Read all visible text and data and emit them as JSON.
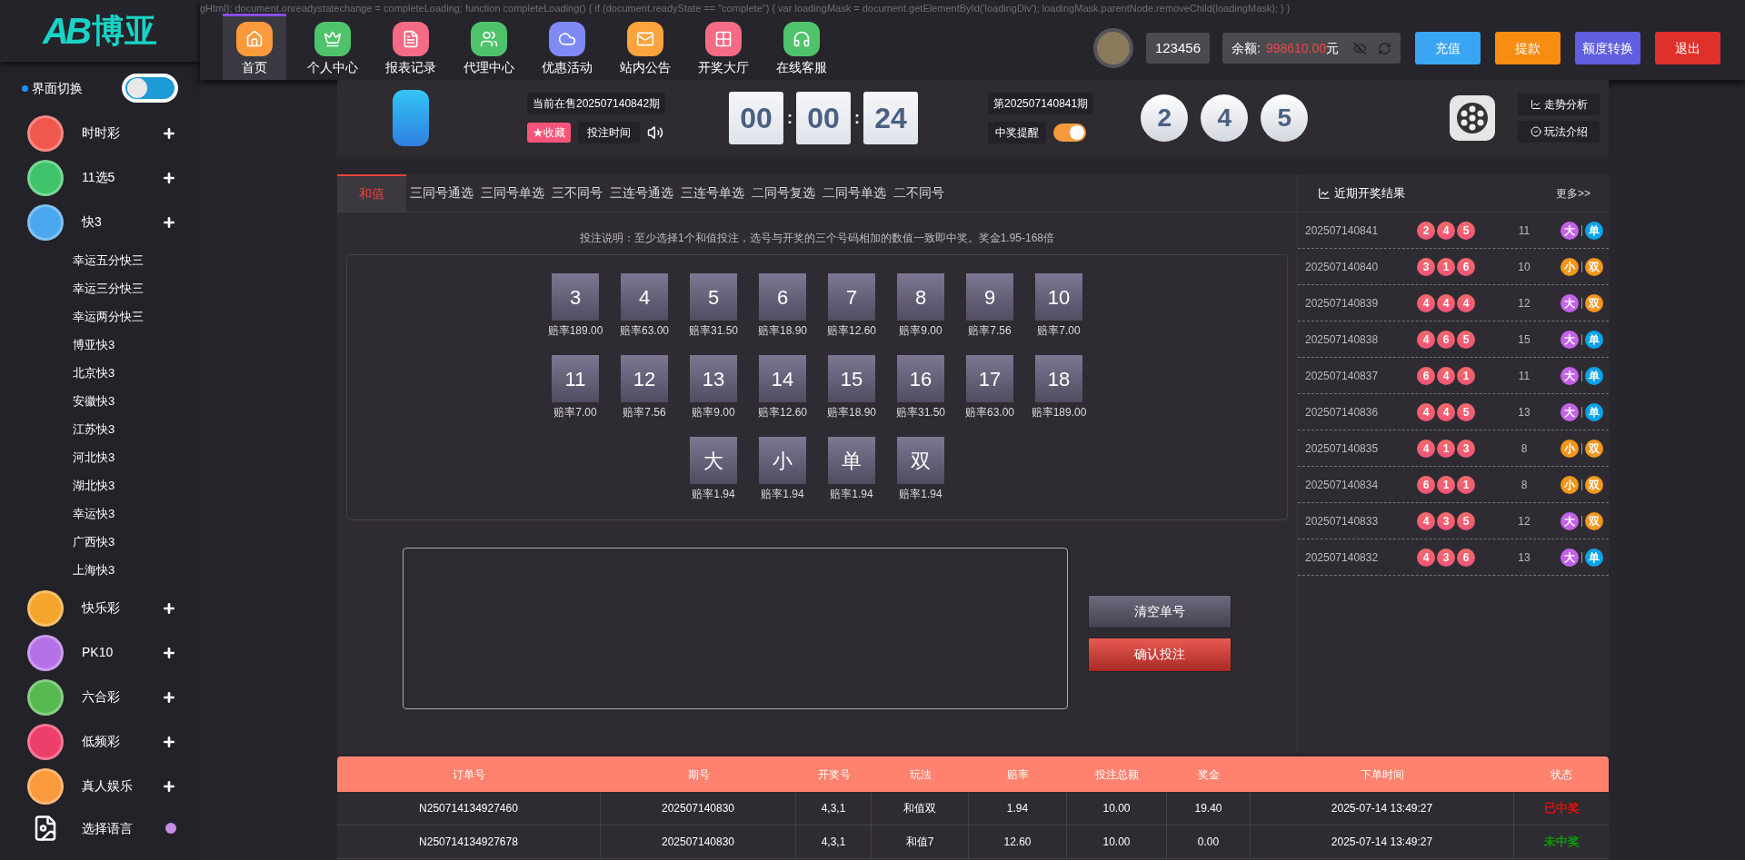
{
  "source_text": "gHtml); document.onreadystatechange = completeLoading; function completeLoading() { if (document.readyState == \"complete\") { var loadingMask = document.getElementById('loadingDiv'); loadingMask.parentNode.removeChild(loadingMask); } }",
  "logo": {
    "mark": "AB",
    "name": "博亚"
  },
  "nav": [
    {
      "label": "首页",
      "selected": true,
      "color": "#fb9a3c"
    },
    {
      "label": "个人中心",
      "selected": false,
      "color": "#4fc36b"
    },
    {
      "label": "报表记录",
      "selected": false,
      "color": "#f56a84"
    },
    {
      "label": "代理中心",
      "selected": false,
      "color": "#4fc36b"
    },
    {
      "label": "优惠活动",
      "selected": false,
      "color": "#7f8af5"
    },
    {
      "label": "站内公告",
      "selected": false,
      "color": "#fba33c"
    },
    {
      "label": "开奖大厅",
      "selected": false,
      "color": "#f56a84"
    },
    {
      "label": "在线客服",
      "selected": false,
      "color": "#4fc36b"
    }
  ],
  "user": {
    "name": "123456",
    "balance_label": "余额:",
    "balance": "998610.00",
    "unit": "元"
  },
  "actions": [
    {
      "label": "充值",
      "color": "#3aa6f3"
    },
    {
      "label": "提款",
      "color": "#f88d14"
    },
    {
      "label": "额度转换",
      "color": "#5f5fe0"
    },
    {
      "label": "退出",
      "color": "#e0302c"
    }
  ],
  "sidebar": {
    "switch": {
      "label": "界面切换",
      "on": false
    },
    "items": [
      {
        "label": "时时彩",
        "color": "#f0584e"
      },
      {
        "label": "11选5",
        "color": "#3fc46b"
      },
      {
        "label": "快3",
        "color": "#4aa8ef",
        "children": [
          {
            "label": "幸运五分快三"
          },
          {
            "label": "幸运三分快三"
          },
          {
            "label": "幸运两分快三"
          },
          {
            "label": "博亚快3"
          },
          {
            "label": "北京快3"
          },
          {
            "label": "安徽快3"
          },
          {
            "label": "江苏快3"
          },
          {
            "label": "河北快3"
          },
          {
            "label": "湖北快3"
          },
          {
            "label": "幸运快3"
          },
          {
            "label": "广西快3"
          },
          {
            "label": "上海快3"
          }
        ]
      },
      {
        "label": "快乐彩",
        "color": "#f4a52c"
      },
      {
        "label": "PK10",
        "color": "#b572e6"
      },
      {
        "label": "六合彩",
        "color": "#56b94f"
      },
      {
        "label": "低频彩",
        "color": "#ec3f6a"
      },
      {
        "label": "真人娱乐",
        "color": "#fb9a3c"
      }
    ],
    "language": {
      "label": "选择语言"
    }
  },
  "game": {
    "current": "当前在售202507140842期",
    "favorite": "★收藏",
    "bet_time": "投注时间",
    "countdown": [
      "00",
      "00",
      "24"
    ],
    "separators": [
      ":",
      ":"
    ],
    "last": "第202507140841期",
    "prize_alert": {
      "label": "中奖提醒",
      "on": true
    },
    "draw": [
      "2",
      "4",
      "5"
    ],
    "links": [
      "走势分析",
      "玩法介绍"
    ]
  },
  "tabs": [
    {
      "label": "和值",
      "selected": true
    },
    {
      "label": "三同号通选",
      "selected": false
    },
    {
      "label": "三同号单选",
      "selected": false
    },
    {
      "label": "三不同号",
      "selected": false
    },
    {
      "label": "三连号通选",
      "selected": false
    },
    {
      "label": "三连号单选",
      "selected": false
    },
    {
      "label": "二同号复选",
      "selected": false
    },
    {
      "label": "二同号单选",
      "selected": false
    },
    {
      "label": "二不同号",
      "selected": false
    }
  ],
  "instructions": "投注说明：至少选择1个和值投注，选号与开奖的三个号码相加的数值一致即中奖。奖金1.95-168倍",
  "bet_rows": [
    [
      {
        "num": "3",
        "odds": "赔率189.00"
      },
      {
        "num": "4",
        "odds": "赔率63.00"
      },
      {
        "num": "5",
        "odds": "赔率31.50"
      },
      {
        "num": "6",
        "odds": "赔率18.90"
      },
      {
        "num": "7",
        "odds": "赔率12.60"
      },
      {
        "num": "8",
        "odds": "赔率9.00"
      },
      {
        "num": "9",
        "odds": "赔率7.56"
      },
      {
        "num": "10",
        "odds": "赔率7.00"
      }
    ],
    [
      {
        "num": "11",
        "odds": "赔率7.00"
      },
      {
        "num": "12",
        "odds": "赔率7.56"
      },
      {
        "num": "13",
        "odds": "赔率9.00"
      },
      {
        "num": "14",
        "odds": "赔率12.60"
      },
      {
        "num": "15",
        "odds": "赔率18.90"
      },
      {
        "num": "16",
        "odds": "赔率31.50"
      },
      {
        "num": "17",
        "odds": "赔率63.00"
      },
      {
        "num": "18",
        "odds": "赔率189.00"
      }
    ],
    [
      {
        "num": "大",
        "odds": "赔率1.94"
      },
      {
        "num": "小",
        "odds": "赔率1.94"
      },
      {
        "num": "单",
        "odds": "赔率1.94"
      },
      {
        "num": "双",
        "odds": "赔率1.94"
      }
    ]
  ],
  "buttons": {
    "clear": "清空单号",
    "confirm": "确认投注"
  },
  "results": {
    "title": "近期开奖结果",
    "more": "更多>>",
    "rows": [
      {
        "issue": "202507140841",
        "balls": [
          "2",
          "4",
          "5"
        ],
        "sum": "11",
        "size": {
          "text": "大",
          "color": "#c462e8"
        },
        "parity": {
          "text": "单",
          "color": "#0aa3ea"
        }
      },
      {
        "issue": "202507140840",
        "balls": [
          "3",
          "1",
          "6"
        ],
        "sum": "10",
        "size": {
          "text": "小",
          "color": "#f3961c"
        },
        "parity": {
          "text": "双",
          "color": "#f3961c"
        }
      },
      {
        "issue": "202507140839",
        "balls": [
          "4",
          "4",
          "4"
        ],
        "sum": "12",
        "size": {
          "text": "大",
          "color": "#c462e8"
        },
        "parity": {
          "text": "双",
          "color": "#f3961c"
        }
      },
      {
        "issue": "202507140838",
        "balls": [
          "4",
          "6",
          "5"
        ],
        "sum": "15",
        "size": {
          "text": "大",
          "color": "#c462e8"
        },
        "parity": {
          "text": "单",
          "color": "#0aa3ea"
        }
      },
      {
        "issue": "202507140837",
        "balls": [
          "6",
          "4",
          "1"
        ],
        "sum": "11",
        "size": {
          "text": "大",
          "color": "#c462e8"
        },
        "parity": {
          "text": "单",
          "color": "#0aa3ea"
        }
      },
      {
        "issue": "202507140836",
        "balls": [
          "4",
          "4",
          "5"
        ],
        "sum": "13",
        "size": {
          "text": "大",
          "color": "#c462e8"
        },
        "parity": {
          "text": "单",
          "color": "#0aa3ea"
        }
      },
      {
        "issue": "202507140835",
        "balls": [
          "4",
          "1",
          "3"
        ],
        "sum": "8",
        "size": {
          "text": "小",
          "color": "#f3961c"
        },
        "parity": {
          "text": "双",
          "color": "#f3961c"
        }
      },
      {
        "issue": "202507140834",
        "balls": [
          "6",
          "1",
          "1"
        ],
        "sum": "8",
        "size": {
          "text": "小",
          "color": "#f3961c"
        },
        "parity": {
          "text": "双",
          "color": "#f3961c"
        }
      },
      {
        "issue": "202507140833",
        "balls": [
          "4",
          "3",
          "5"
        ],
        "sum": "12",
        "size": {
          "text": "大",
          "color": "#c462e8"
        },
        "parity": {
          "text": "双",
          "color": "#f3961c"
        }
      },
      {
        "issue": "202507140832",
        "balls": [
          "4",
          "3",
          "6"
        ],
        "sum": "13",
        "size": {
          "text": "大",
          "color": "#c462e8"
        },
        "parity": {
          "text": "单",
          "color": "#0aa3ea"
        }
      }
    ]
  },
  "orders": {
    "columns": [
      "订单号",
      "期号",
      "开奖号",
      "玩法",
      "赔率",
      "投注总额",
      "奖金",
      "下单时间",
      "状态"
    ],
    "rows": [
      {
        "cells": [
          "N250714134927460",
          "202507140830",
          "4,3,1",
          "和值双",
          "1.94",
          "10.00",
          "19.40",
          "2025-07-14 13:49:27"
        ],
        "status": "已中奖",
        "color": "#e01010"
      },
      {
        "cells": [
          "N250714134927678",
          "202507140830",
          "4,3,1",
          "和值7",
          "12.60",
          "10.00",
          "0.00",
          "2025-07-14 13:49:27"
        ],
        "status": "未中奖",
        "color": "#0c9a0c"
      }
    ]
  }
}
